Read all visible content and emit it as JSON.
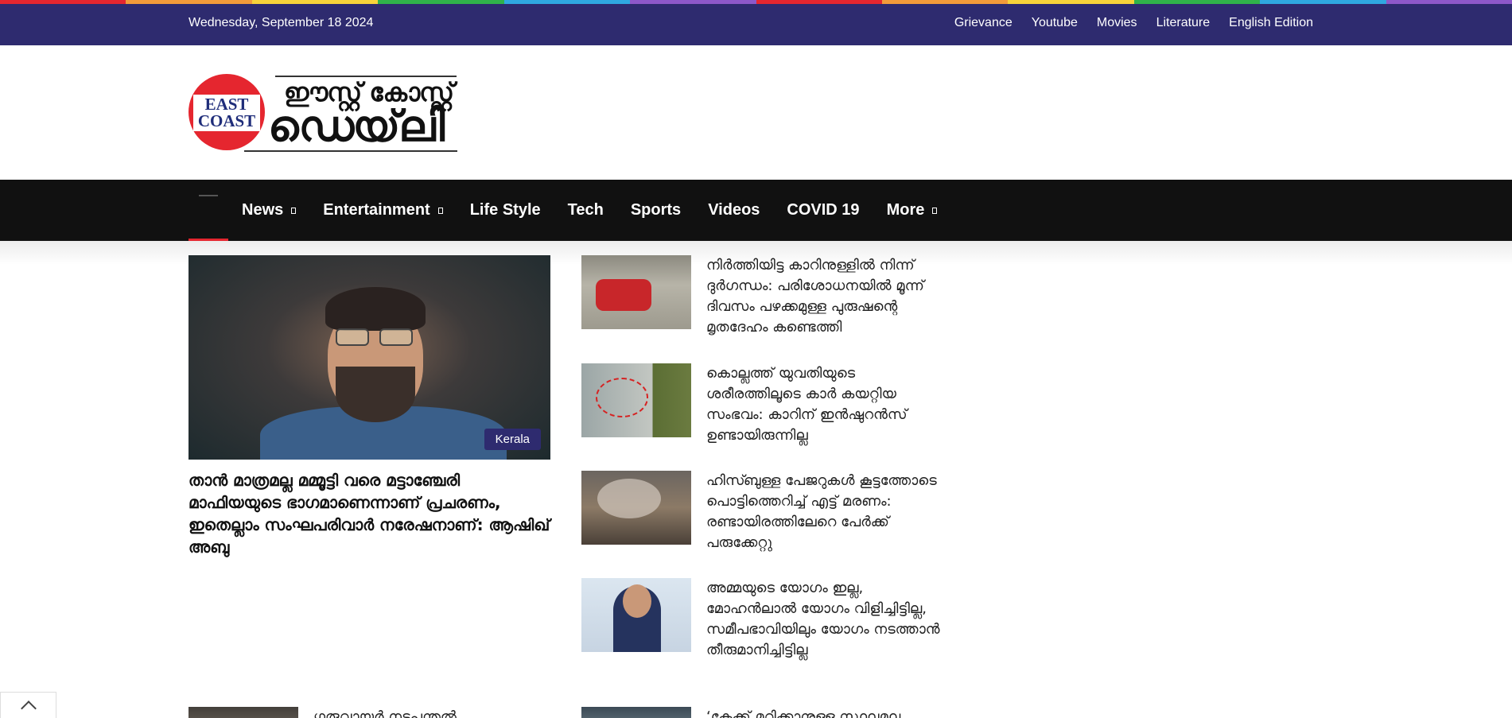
{
  "rainbow_colors": [
    "#e5262f",
    "#f29b3a",
    "#f7d33a",
    "#30b24a",
    "#2fa8e0",
    "#8d58c9",
    "#e5262f",
    "#f29b3a",
    "#f7d33a",
    "#30b24a",
    "#2fa8e0",
    "#8d58c9"
  ],
  "topbar": {
    "date": "Wednesday, September 18 2024",
    "links": [
      "Grievance",
      "Youtube",
      "Movies",
      "Literature",
      "English Edition"
    ]
  },
  "logo": {
    "circle_line1": "EAST",
    "circle_line2": "COAST",
    "text_line1": "ഈസ്റ്റ് കോസ്റ്റ്",
    "text_line2": "ഡെയ്‌ലി"
  },
  "nav": {
    "items": [
      {
        "label": "News",
        "has_dropdown": true
      },
      {
        "label": "Entertainment",
        "has_dropdown": true
      },
      {
        "label": "Life Style",
        "has_dropdown": false
      },
      {
        "label": "Tech",
        "has_dropdown": false
      },
      {
        "label": "Sports",
        "has_dropdown": false
      },
      {
        "label": "Videos",
        "has_dropdown": false
      },
      {
        "label": "COVID 19",
        "has_dropdown": false
      },
      {
        "label": "More",
        "has_dropdown": true
      }
    ]
  },
  "lead": {
    "badge": "Kerala",
    "title": "താൻ മാത്രമല്ല മമ്മൂട്ടി വരെ മട്ടാഞ്ചേരി മാഫിയയുടെ ഭാഗമാണെന്നാണ് പ്രചരണം, ഇതെല്ലാം സംഘപരിവാർ നരേഷനാണ്: ആഷിഖ് അബു"
  },
  "side": [
    {
      "title": "നിർത്തിയിട്ട കാറിനുള്ളിൽ നിന്ന് ദുർഗന്ധം: പരിശോധനയിൽ മൂന്ന് ദിവസം പഴക്കമുള്ള പുരുഷന്റെ മൃതദേഹം കണ്ടെത്തി"
    },
    {
      "title": "കൊല്ലത്ത് യുവതിയുടെ ശരീരത്തിലൂടെ കാർ കയറ്റിയ സംഭവം: കാറിന് ഇൻഷുറൻസ് ഉണ്ടായിരുന്നില്ല"
    },
    {
      "title": "ഹിസ്ബുള്ള പേജറുകൾ കൂട്ടത്തോടെ പൊട്ടിത്തെറിച്ച് എട്ട് മരണം: രണ്ടായിരത്തിലേറെ പേർക്ക് പരുക്കേറ്റു"
    },
    {
      "title": "അമ്മയുടെ യോഗം ഇല്ല, മോഹൻലാൽ യോഗം വിളിച്ചിട്ടില്ല, സമീപഭാവിയിലും യോഗം നടത്താൻ തീരുമാനിച്ചിട്ടില്ല"
    },
    {
      "title": "‘കേക്ക് മുറിക്കാനുള്ള സ്ഥലമല്ല"
    }
  ],
  "bottom_left": {
    "title": "ഗുരുവായൂർ നടപ്പന്തൽ"
  }
}
